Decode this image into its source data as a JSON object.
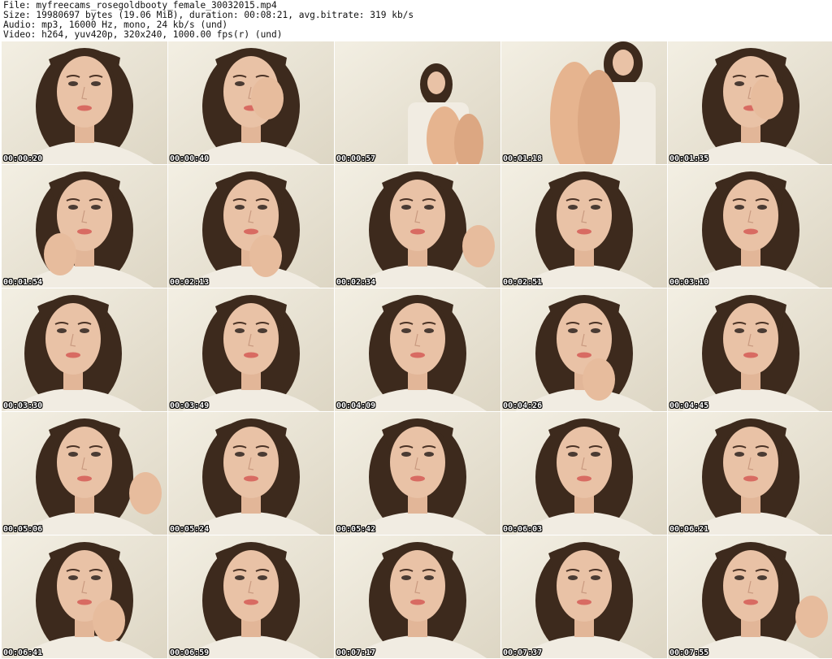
{
  "header": {
    "file": "File: myfreecams_rosegoldbooty_female_30032015.mp4",
    "size": "Size: 19980697 bytes (19.06 MiB), duration: 00:08:21, avg.bitrate: 319 kb/s",
    "audio": "Audio: mp3, 16000 Hz, mono, 24 kb/s (und)",
    "video": "Video: h264, yuv420p, 320x240, 1000.00 fps(r) (und)"
  },
  "thumbnails": [
    {
      "timestamp": "00:00:20",
      "pose": "face"
    },
    {
      "timestamp": "00:00:40",
      "pose": "hand-face"
    },
    {
      "timestamp": "00:00:57",
      "pose": "far-knees"
    },
    {
      "timestamp": "00:01:18",
      "pose": "legs"
    },
    {
      "timestamp": "00:01:35",
      "pose": "hand-face"
    },
    {
      "timestamp": "00:01:54",
      "pose": "lipstick"
    },
    {
      "timestamp": "00:02:13",
      "pose": "hand-chin"
    },
    {
      "timestamp": "00:02:34",
      "pose": "finger"
    },
    {
      "timestamp": "00:02:51",
      "pose": "face"
    },
    {
      "timestamp": "00:03:10",
      "pose": "face"
    },
    {
      "timestamp": "00:03:30",
      "pose": "face-left"
    },
    {
      "timestamp": "00:03:49",
      "pose": "face"
    },
    {
      "timestamp": "00:04:09",
      "pose": "face"
    },
    {
      "timestamp": "00:04:26",
      "pose": "hand-chin"
    },
    {
      "timestamp": "00:04:45",
      "pose": "face"
    },
    {
      "timestamp": "00:05:06",
      "pose": "hand-right"
    },
    {
      "timestamp": "00:05:24",
      "pose": "face"
    },
    {
      "timestamp": "00:05:42",
      "pose": "face"
    },
    {
      "timestamp": "00:06:03",
      "pose": "face"
    },
    {
      "timestamp": "00:06:21",
      "pose": "face"
    },
    {
      "timestamp": "00:06:41",
      "pose": "hand-hair"
    },
    {
      "timestamp": "00:06:59",
      "pose": "face"
    },
    {
      "timestamp": "00:07:17",
      "pose": "face"
    },
    {
      "timestamp": "00:07:37",
      "pose": "face"
    },
    {
      "timestamp": "00:07:55",
      "pose": "hand-right"
    }
  ],
  "colors": {
    "background": "#ffffff",
    "wall": "#ece7d9",
    "hair": "#3d2a1d",
    "skin": "#e9c2a6",
    "shirt": "#f1ece2",
    "lips": "#d86b62",
    "timestamp_text": "#ffffff"
  }
}
